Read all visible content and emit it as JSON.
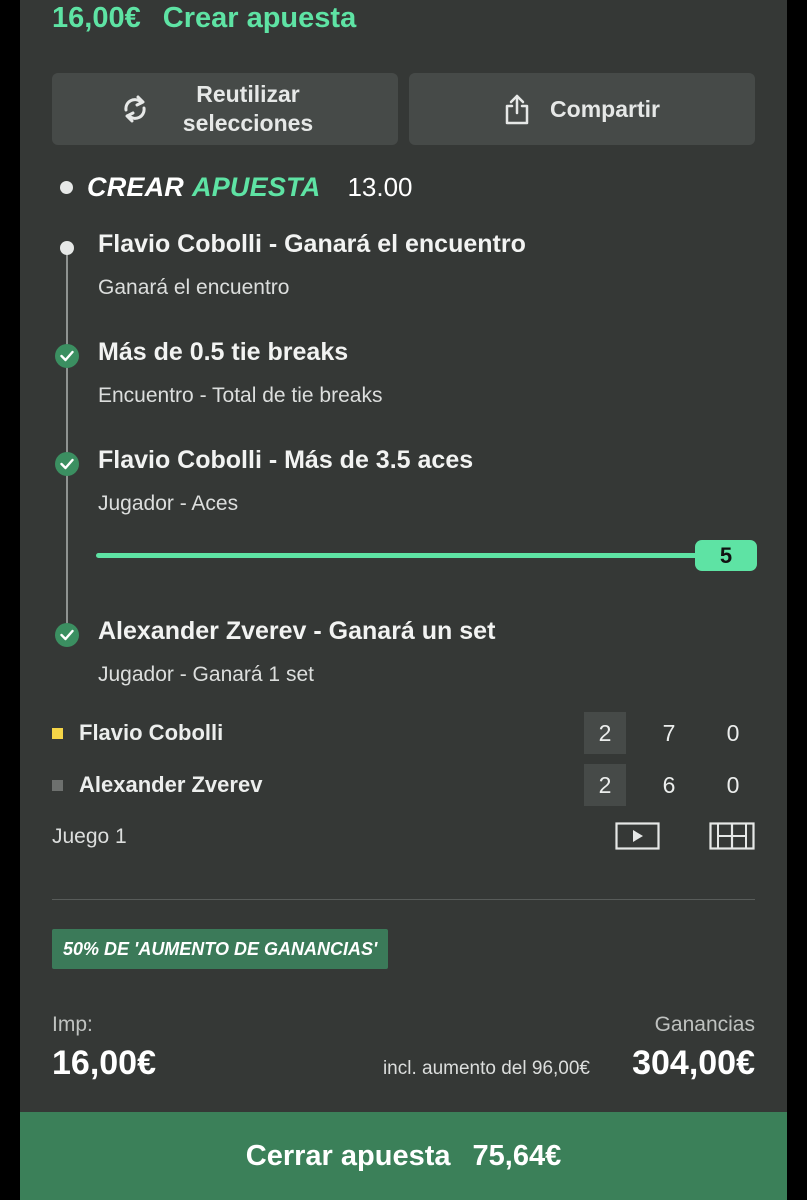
{
  "header": {
    "amount": "16,00€",
    "title": "Crear apuesta"
  },
  "actions": {
    "reuse_label": "Reutilizar selecciones",
    "share_label": "Compartir"
  },
  "builder": {
    "brand_word1": "CREAR",
    "brand_word2": "APUESTA",
    "odds": "13.00"
  },
  "selections": [
    {
      "title": "Flavio Cobolli - Ganará el encuentro",
      "subtitle": "Ganará el encuentro",
      "status": "pending"
    },
    {
      "title": "Más de 0.5 tie breaks",
      "subtitle": "Encuentro - Total de tie breaks",
      "status": "won"
    },
    {
      "title": "Flavio Cobolli - Más de 3.5 aces",
      "subtitle": "Jugador - Aces",
      "status": "won",
      "progress_value": "5",
      "progress_fraction": 1.0
    },
    {
      "title": "Alexander Zverev - Ganará un set",
      "subtitle": "Jugador - Ganará 1 set",
      "status": "won"
    }
  ],
  "scoreboard": {
    "players": [
      {
        "name": "Flavio Cobolli",
        "serving_color": "#f5d547",
        "scores": [
          "2",
          "7",
          "0"
        ]
      },
      {
        "name": "Alexander Zverev",
        "serving_color": "#6d706e",
        "scores": [
          "2",
          "6",
          "0"
        ]
      }
    ],
    "game_label": "Juego 1"
  },
  "promo": {
    "badge": "50% DE 'AUMENTO DE GANANCIAS'"
  },
  "stake": {
    "label": "Imp:",
    "value": "16,00€"
  },
  "winnings": {
    "label": "Ganancias",
    "boost_note": "incl. aumento del 96,00€",
    "value": "304,00€"
  },
  "cashout": {
    "label": "Cerrar apuesta",
    "value": "75,64€"
  },
  "colors": {
    "accent": "#5ee3a4",
    "panel": "#353836",
    "button_bg": "#464a48",
    "success": "#3b8f61",
    "cashout_bg": "#3b8059"
  }
}
